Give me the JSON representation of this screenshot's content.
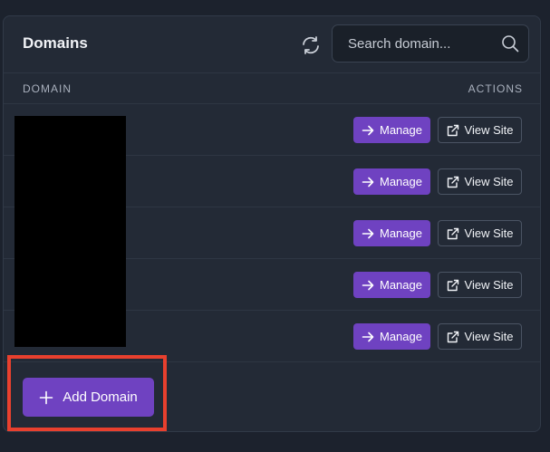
{
  "header": {
    "title": "Domains",
    "refresh_icon": "refresh-icon",
    "search": {
      "placeholder": "Search domain...",
      "value": "",
      "icon": "search-icon"
    }
  },
  "table": {
    "columns": [
      "DOMAIN",
      "ACTIONS"
    ],
    "rows": [
      {
        "manage_label": "Manage",
        "view_label": "View Site"
      },
      {
        "manage_label": "Manage",
        "view_label": "View Site"
      },
      {
        "manage_label": "Manage",
        "view_label": "View Site"
      },
      {
        "manage_label": "Manage",
        "view_label": "View Site"
      },
      {
        "manage_label": "Manage",
        "view_label": "View Site"
      }
    ]
  },
  "footer": {
    "add_label": "Add Domain"
  },
  "colors": {
    "accent": "#6f42c1",
    "highlight": "#e8402e",
    "background": "#1c222d",
    "panel": "#232a36"
  }
}
